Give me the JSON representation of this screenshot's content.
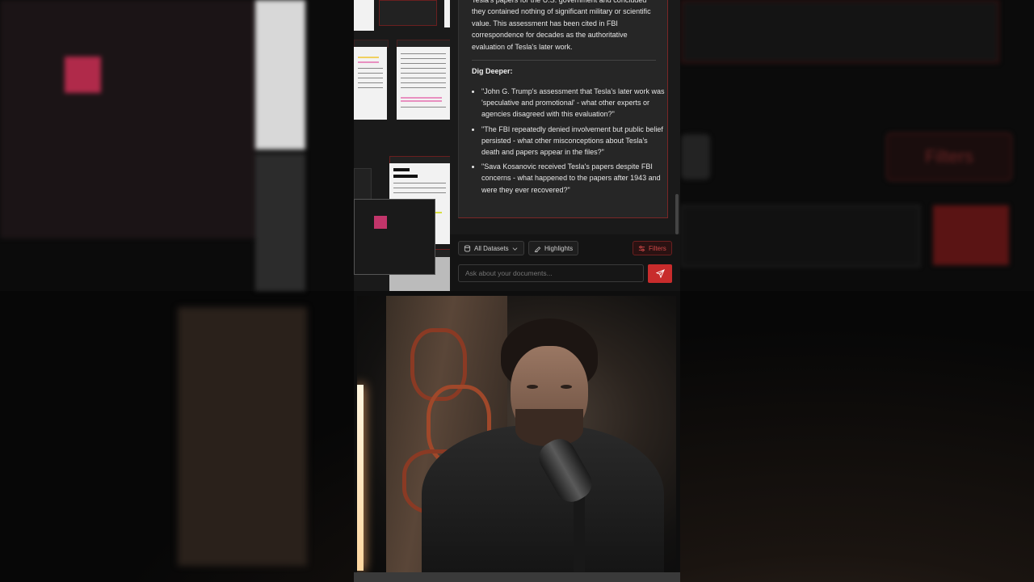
{
  "answer": {
    "text": "Tesla's papers for the U.S. government and concluded they contained nothing of significant military or scientific value. This assessment has been cited in FBI correspondence for decades as the authoritative evaluation of Tesla's later work."
  },
  "dig_deeper": {
    "title": "Dig Deeper:",
    "items": [
      "\"John G. Trump's assessment that Tesla's later work was 'speculative and promotional' - what other experts or agencies disagreed with this evaluation?\"",
      "\"The FBI repeatedly denied involvement but public belief persisted - what other misconceptions about Tesla's death and papers appear in the files?\"",
      "\"Sava Kosanovic received Tesla's papers despite FBI concerns - what happened to the papers after 1943 and were they ever recovered?\""
    ]
  },
  "toolbar": {
    "datasets_label": "All Datasets",
    "highlights_label": "Highlights",
    "filters_label": "Filters"
  },
  "input": {
    "placeholder": "Ask about your documents..."
  },
  "background": {
    "filters_label": "Filters"
  },
  "colors": {
    "accent": "#c82c2c",
    "panel": "#262626",
    "background": "#0e0e0e"
  },
  "icons": [
    "database-icon",
    "chevron-down-icon",
    "highlighter-icon",
    "sliders-icon",
    "send-icon"
  ]
}
